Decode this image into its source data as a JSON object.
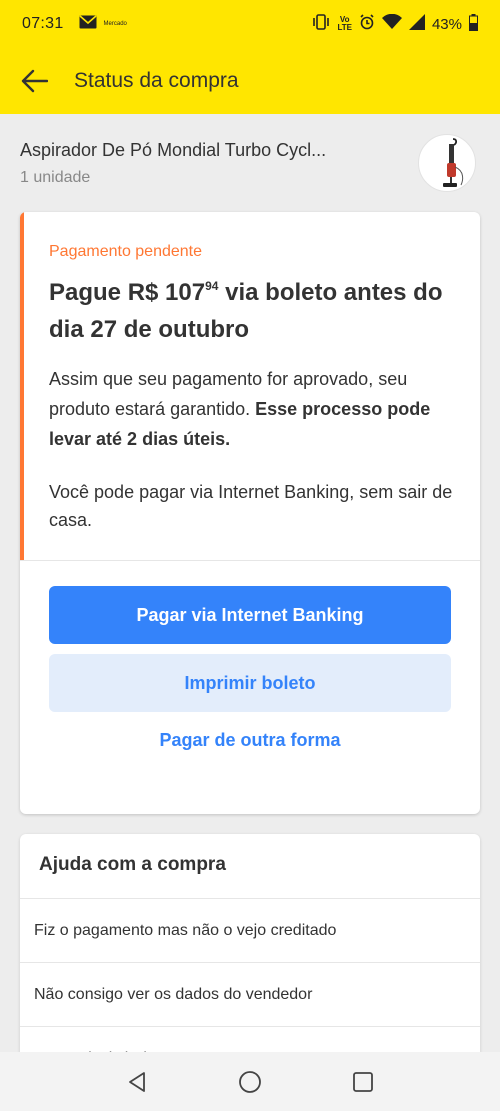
{
  "status_bar": {
    "time": "07:31",
    "carrier_small": "Mercado",
    "volte_top": "Vo",
    "volte_bottom": "LTE",
    "battery": "43%"
  },
  "app_bar": {
    "title": "Status da compra"
  },
  "product": {
    "name": "Aspirador De Pó Mondial Turbo Cycl...",
    "quantity": "1 unidade"
  },
  "payment": {
    "status": "Pagamento pendente",
    "headline_prefix": "Pague R$ 107",
    "headline_cents": "94",
    "headline_suffix": " via boleto antes do dia 27 de outubro",
    "para1_normal": "Assim que seu pagamento for aprovado, seu produto estará garantido. ",
    "para1_bold": "Esse processo pode levar até 2 dias úteis.",
    "para2": "Você pode pagar via Internet Banking, sem sair de casa.",
    "primary_button": "Pagar via Internet Banking",
    "secondary_button": "Imprimir boleto",
    "link": "Pagar de outra forma"
  },
  "help": {
    "title": "Ajuda com a compra",
    "items": [
      "Fiz o pagamento mas não o vejo creditado",
      "Não consigo ver os dados do vendedor",
      "Quero desistir da compra"
    ]
  },
  "colors": {
    "brand_yellow": "#ffe600",
    "accent_orange": "#ff7733",
    "primary_blue": "#3483fa",
    "secondary_blue_bg": "#e3edfb"
  },
  "icons": [
    "back-arrow-icon",
    "mail-icon",
    "vibrate-icon",
    "alarm-icon",
    "wifi-icon",
    "signal-icon",
    "battery-icon",
    "nav-back-icon",
    "nav-home-icon",
    "nav-recents-icon"
  ]
}
